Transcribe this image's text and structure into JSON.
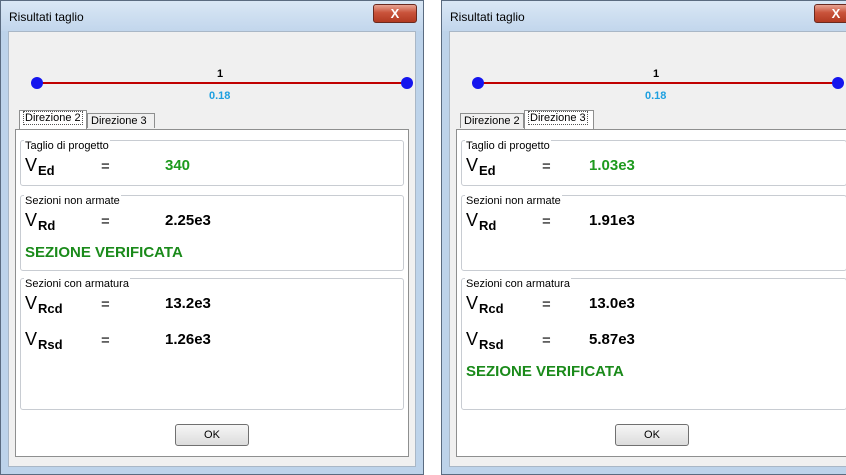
{
  "windows": [
    {
      "title": "Risultati taglio",
      "close_symbol": "X",
      "beam": {
        "element_number": "1",
        "value": "0.18"
      },
      "tabs": [
        "Direzione 2",
        "Direzione 3"
      ],
      "active_tab": "Direzione 2",
      "design": {
        "label": "Taglio di progetto",
        "symbol": "V",
        "subscript": "Ed",
        "equals": "=",
        "value": "340"
      },
      "unreinforced": {
        "label": "Sezioni non armate",
        "symbol": "V",
        "subscript": "Rd",
        "equals": "=",
        "value": "2.25e3",
        "verdict": "SEZIONE VERIFICATA"
      },
      "reinforced": {
        "label": "Sezioni con armatura",
        "rows": [
          {
            "symbol": "V",
            "subscript": "Rcd",
            "equals": "=",
            "value": "13.2e3"
          },
          {
            "symbol": "V",
            "subscript": "Rsd",
            "equals": "=",
            "value": "1.26e3"
          }
        ],
        "verdict": ""
      },
      "ok_label": "OK"
    },
    {
      "title": "Risultati taglio",
      "close_symbol": "X",
      "beam": {
        "element_number": "1",
        "value": "0.18"
      },
      "tabs": [
        "Direzione 2",
        "Direzione 3"
      ],
      "active_tab": "Direzione 3",
      "design": {
        "label": "Taglio di progetto",
        "symbol": "V",
        "subscript": "Ed",
        "equals": "=",
        "value": "1.03e3"
      },
      "unreinforced": {
        "label": "Sezioni non armate",
        "symbol": "V",
        "subscript": "Rd",
        "equals": "=",
        "value": "1.91e3",
        "verdict": ""
      },
      "reinforced": {
        "label": "Sezioni con armatura",
        "rows": [
          {
            "symbol": "V",
            "subscript": "Rcd",
            "equals": "=",
            "value": "13.0e3"
          },
          {
            "symbol": "V",
            "subscript": "Rsd",
            "equals": "=",
            "value": "5.87e3"
          }
        ],
        "verdict": "SEZIONE VERIFICATA"
      },
      "ok_label": "OK"
    }
  ],
  "colors": {
    "beam_line": "#c00000",
    "beam_nodes": "#1515ee",
    "beam_value": "#1ea0e0",
    "design_value": "#1e9a1e",
    "verdict": "#1a8a1a"
  }
}
